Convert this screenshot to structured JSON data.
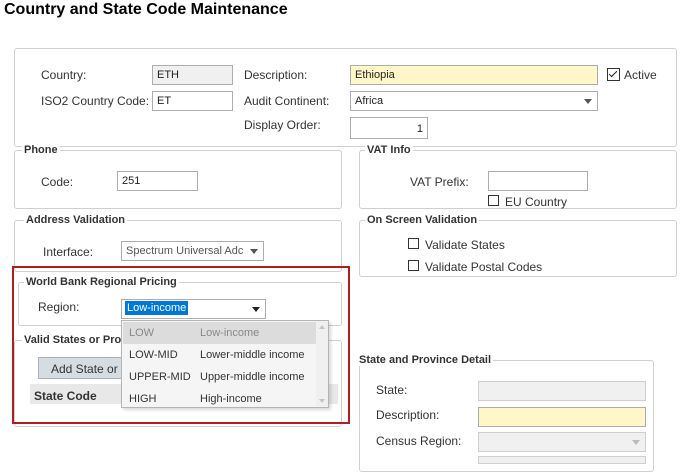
{
  "page": {
    "title": "Country and State Code  Maintenance"
  },
  "country": {
    "country_label": "Country:",
    "country_value": "ETH",
    "iso2_label": "ISO2 Country Code:",
    "iso2_value": "ET",
    "description_label": "Description:",
    "description_value": "Ethiopia",
    "audit_continent_label": "Audit Continent:",
    "audit_continent_value": "Africa",
    "display_order_label": "Display Order:",
    "display_order_value": "1",
    "active_label": "Active",
    "active_checked": true
  },
  "phone": {
    "legend": "Phone",
    "code_label": "Code:",
    "code_value": "251"
  },
  "vat": {
    "legend": "VAT Info",
    "prefix_label": "VAT Prefix:",
    "prefix_value": "",
    "eu_label": "EU Country",
    "eu_checked": false
  },
  "address_validation": {
    "legend": "Address Validation",
    "interface_label": "Interface:",
    "interface_value": "Spectrum Universal Adc"
  },
  "on_screen_validation": {
    "legend": "On Screen Validation",
    "validate_states_label": "Validate States",
    "validate_postal_label": "Validate Postal Codes"
  },
  "world_bank": {
    "legend": "World Bank Regional Pricing",
    "region_label": "Region:",
    "region_value": "Low-income",
    "options": [
      {
        "code": "LOW",
        "label": "Low-income"
      },
      {
        "code": "LOW-MID",
        "label": "Lower-middle income"
      },
      {
        "code": "UPPER-MID",
        "label": "Upper-middle income"
      },
      {
        "code": "HIGH",
        "label": "High-income"
      }
    ]
  },
  "valid_states": {
    "legend": "Valid States or Prov",
    "add_button": "Add State or P",
    "state_code_header": "State Code"
  },
  "state_detail": {
    "legend": "State and Province Detail",
    "state_label": "State:",
    "description_label": "Description:",
    "census_region_label": "Census Region:"
  },
  "colors": {
    "highlight_red": "#b01e1e",
    "required_yellow": "#fff7c8",
    "selection_blue": "#0078d7"
  },
  "icons": {
    "dropdown": "chevron-down-icon",
    "checkbox": "checkbox-icon"
  }
}
